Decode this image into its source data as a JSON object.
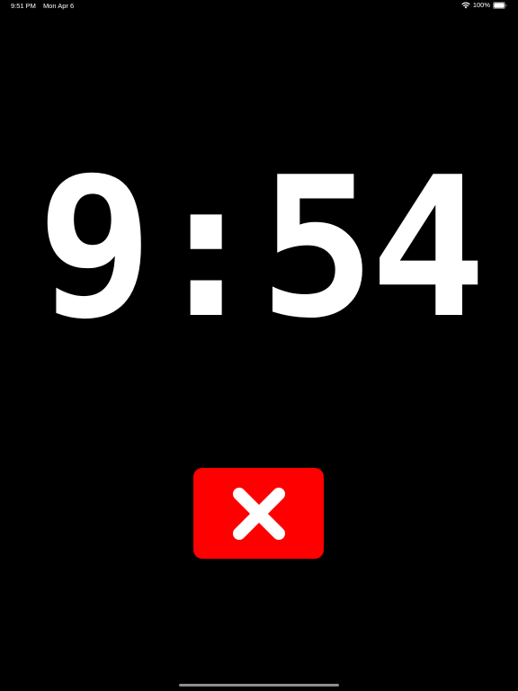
{
  "status_bar": {
    "time": "9:51 PM",
    "date": "Mon Apr 6",
    "battery_percent": "100%",
    "battery_level": 1.0,
    "wifi_icon": "wifi-icon",
    "battery_icon": "battery-icon"
  },
  "clock": {
    "display": "9:54"
  },
  "dismiss_button": {
    "icon": "close-icon",
    "background_color": "#ff0000",
    "icon_color": "#ffffff"
  },
  "colors": {
    "background": "#000000",
    "text": "#ffffff",
    "home_indicator": "#8e8e8e"
  }
}
